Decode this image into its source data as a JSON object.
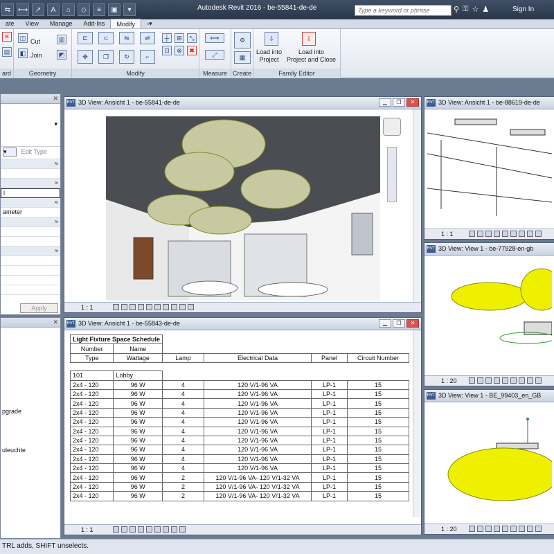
{
  "app": {
    "title": "Autodesk Revit 2016 -     be-55841-de-de",
    "search_placeholder": "Type a keyword or phrase",
    "sign_in": "Sign In"
  },
  "tabs": [
    "ate",
    "View",
    "Manage",
    "Add-Ins",
    "Modify"
  ],
  "ribbon": {
    "panels": [
      "ard",
      "Geometry",
      "Modify",
      "Measure",
      "Create",
      "Family Editor"
    ],
    "cut": "Cut",
    "join": "Join",
    "load_project": "Load into\nProject",
    "load_close": "Load into\nProject and Close"
  },
  "properties": {
    "edit_type": "Edit Type",
    "parameter_text": "ameter",
    "l_text": "l",
    "apply": "Apply"
  },
  "browser": {
    "items": [
      "pgrade",
      "uleuchte"
    ]
  },
  "views": {
    "main3d": {
      "title": "3D View: Ansicht 1 - be-55841-de-de",
      "scale": "1 : 1"
    },
    "tr": {
      "title": "3D View: Ansicht 1 - be-88619-de-de",
      "scale": "1 : 1"
    },
    "mr": {
      "title": "3D View: View 1 - be-77928-en-gb",
      "scale": "1 : 20"
    },
    "br": {
      "title": "3D View: View 1 - BE_99403_en_GB",
      "scale": "1 : 20"
    },
    "sched": {
      "title": "3D View: Ansicht 1 - be-55843-de-de",
      "scale": "1 : 1"
    }
  },
  "schedule": {
    "title": "Light Fixture Space Schedule",
    "headers_row1": [
      "Number",
      "Name"
    ],
    "headers_row2": [
      "Type",
      "Wattage",
      "Lamp",
      "Electrical Data",
      "Panel",
      "Circuit Number"
    ],
    "group": [
      "101",
      "Lobby"
    ],
    "rows": [
      [
        "2x4 - 120",
        "96 W",
        "4",
        "120 V/1-96 VA",
        "LP-1",
        "15"
      ],
      [
        "2x4 - 120",
        "96 W",
        "4",
        "120 V/1-96 VA",
        "LP-1",
        "15"
      ],
      [
        "2x4 - 120",
        "96 W",
        "4",
        "120 V/1-96 VA",
        "LP-1",
        "15"
      ],
      [
        "2x4 - 120",
        "96 W",
        "4",
        "120 V/1-96 VA",
        "LP-1",
        "15"
      ],
      [
        "2x4 - 120",
        "96 W",
        "4",
        "120 V/1-96 VA",
        "LP-1",
        "15"
      ],
      [
        "2x4 - 120",
        "96 W",
        "4",
        "120 V/1-96 VA",
        "LP-1",
        "15"
      ],
      [
        "2x4 - 120",
        "96 W",
        "4",
        "120 V/1-96 VA",
        "LP-1",
        "15"
      ],
      [
        "2x4 - 120",
        "96 W",
        "4",
        "120 V/1-96 VA",
        "LP-1",
        "15"
      ],
      [
        "2x4 - 120",
        "96 W",
        "4",
        "120 V/1-96 VA",
        "LP-1",
        "15"
      ],
      [
        "2x4 - 120",
        "96 W",
        "4",
        "120 V/1-96 VA",
        "LP-1",
        "15"
      ],
      [
        "2x4 - 120",
        "96 W",
        "2",
        "120 V/1-96 VA- 120 V/1-32 VA",
        "LP-1",
        "15"
      ],
      [
        "2x4 - 120",
        "96 W",
        "2",
        "120 V/1-96 VA- 120 V/1-32 VA",
        "LP-1",
        "15"
      ],
      [
        "2x4 - 120",
        "96 W",
        "2",
        "120 V/1-96 VA- 120 V/1-32 VA",
        "LP-1",
        "15"
      ]
    ]
  },
  "status": "TRL adds, SHIFT unselects."
}
